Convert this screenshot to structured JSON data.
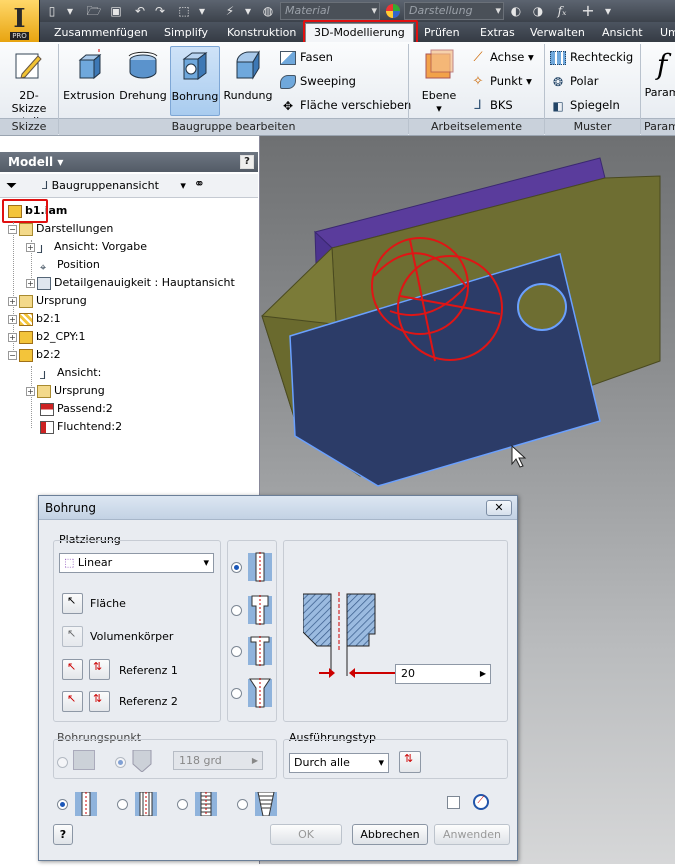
{
  "qat": {
    "material": "Material",
    "appearance": "Darstellung",
    "app_badge": "PRO"
  },
  "tabs": [
    "Zusammenfügen",
    "Simplify",
    "Konstruktion",
    "3D-Modellierung",
    "Prüfen",
    "Extras",
    "Verwalten",
    "Ansicht",
    "Um"
  ],
  "ribbon": {
    "sketch_btn": "2D-Skizze erstellen",
    "sketch_grp": "Skizze",
    "extrusion": "Extrusion",
    "drehung": "Drehung",
    "bohrung": "Bohrung",
    "rundung": "Rundung",
    "fasen": "Fasen",
    "sweeping": "Sweeping",
    "flaeche": "Fläche verschieben",
    "edit_grp": "Baugruppe bearbeiten",
    "ebene": "Ebene",
    "achse": "Achse",
    "punkt": "Punkt",
    "bks": "BKS",
    "work_grp": "Arbeitselemente",
    "rechteckig": "Rechteckig",
    "polar": "Polar",
    "spiegeln": "Spiegeln",
    "muster_grp": "Muster",
    "param": "Param",
    "param_grp": "Param"
  },
  "panel": {
    "title": "Modell",
    "view": "Baugruppenansicht",
    "tree": [
      {
        "label": "b1.iam",
        "bold": true
      },
      {
        "label": "Darstellungen"
      },
      {
        "label": "Ansicht: Vorgabe"
      },
      {
        "label": "Position"
      },
      {
        "label": "Detailgenauigkeit : Hauptansicht"
      },
      {
        "label": "Ursprung"
      },
      {
        "label": "b2:1"
      },
      {
        "label": "b2_CPY:1"
      },
      {
        "label": "b2:2"
      },
      {
        "label": "Ansicht:"
      },
      {
        "label": "Ursprung"
      },
      {
        "label": "Passend:2"
      },
      {
        "label": "Fluchtend:2"
      }
    ]
  },
  "dialog": {
    "title": "Bohrung",
    "placement_label": "Platzierung",
    "placement_value": "Linear",
    "flaeche": "Fläche",
    "volumen": "Volumenkörper",
    "ref1": "Referenz 1",
    "ref2": "Referenz 2",
    "diameter": "20",
    "bohrungspunkt": "Bohrungspunkt",
    "angle": "118 grd",
    "ausfuehrung_label": "Ausführungstyp",
    "ausfuehrung_value": "Durch alle",
    "ok": "OK",
    "cancel": "Abbrechen",
    "apply": "Anwenden",
    "help": "?"
  },
  "colors": {
    "accent_red": "#e01010",
    "face_blue": "#2c3c68",
    "body_olive": "#6e6e32",
    "purple": "#5a3c9c"
  }
}
